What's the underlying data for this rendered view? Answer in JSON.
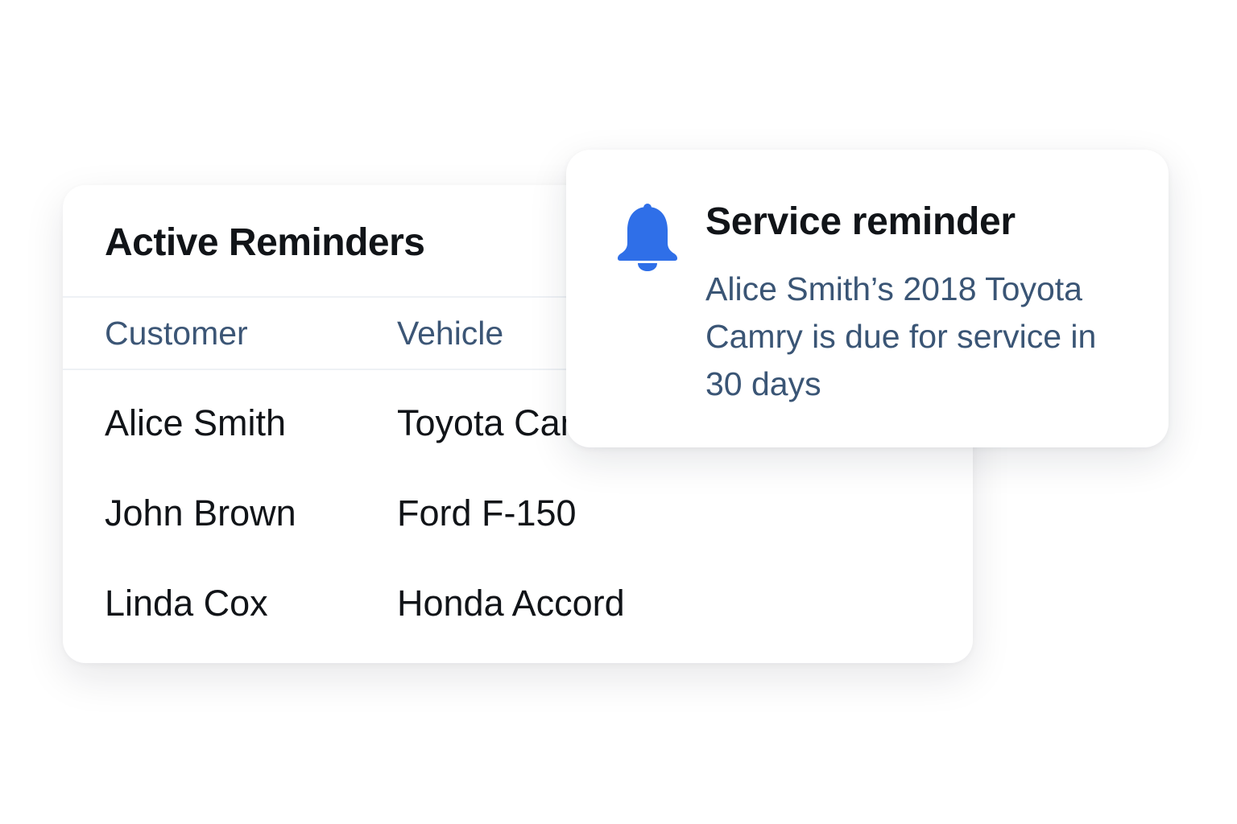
{
  "reminders": {
    "title": "Active Reminders",
    "columns": {
      "customer": "Customer",
      "vehicle": "Vehicle"
    },
    "rows": [
      {
        "customer": "Alice Smith",
        "vehicle": "Toyota Camry"
      },
      {
        "customer": "John Brown",
        "vehicle": "Ford F-150"
      },
      {
        "customer": "Linda Cox",
        "vehicle": "Honda Accord"
      }
    ]
  },
  "notification": {
    "icon": "bell-icon",
    "title": "Service reminder",
    "message": "Alice Smith’s 2018 Toyota Camry is due for service in 30 days"
  },
  "colors": {
    "accent": "#2f6fe8",
    "title_text": "#111418",
    "muted_text": "#3c5676",
    "background": "#ffffff"
  }
}
